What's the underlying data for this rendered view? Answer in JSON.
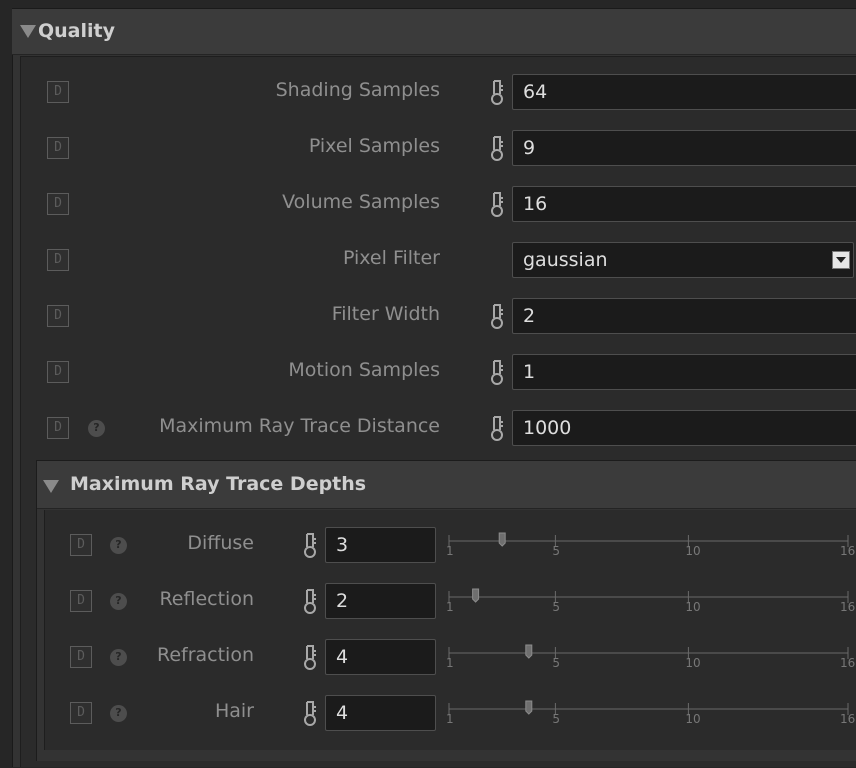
{
  "section": {
    "title": "Quality",
    "rows": [
      {
        "label": "Shading Samples",
        "value": "64",
        "type": "number",
        "help": false
      },
      {
        "label": "Pixel Samples",
        "value": "9",
        "type": "number",
        "help": false
      },
      {
        "label": "Volume Samples",
        "value": "16",
        "type": "number",
        "help": false
      },
      {
        "label": "Pixel Filter",
        "value": "gaussian",
        "type": "dropdown",
        "help": false
      },
      {
        "label": "Filter Width",
        "value": "2",
        "type": "number",
        "help": false
      },
      {
        "label": "Motion Samples",
        "value": "1",
        "type": "number",
        "help": false
      },
      {
        "label": "Maximum Ray Trace Distance",
        "value": "1000",
        "type": "number",
        "help": true
      }
    ]
  },
  "subsection": {
    "title": "Maximum Ray Trace Depths",
    "slider_ticks": [
      "1",
      "5",
      "10",
      "16"
    ],
    "slider_range": [
      1,
      16
    ],
    "rows": [
      {
        "label": "Diffuse",
        "value": "3",
        "slider_value": 3
      },
      {
        "label": "Reflection",
        "value": "2",
        "slider_value": 2
      },
      {
        "label": "Refraction",
        "value": "4",
        "slider_value": 4
      },
      {
        "label": "Hair",
        "value": "4",
        "slider_value": 4
      }
    ]
  },
  "default_button_label": "D",
  "help_glyph": "?",
  "icons": {
    "anim": "animation-key-icon",
    "collapse": "collapse-triangle-icon"
  },
  "colors": {
    "field_bg": "#1b1b1b",
    "panel_bg": "#333333",
    "text": "#8f8f8f",
    "value_text": "#dedede"
  }
}
